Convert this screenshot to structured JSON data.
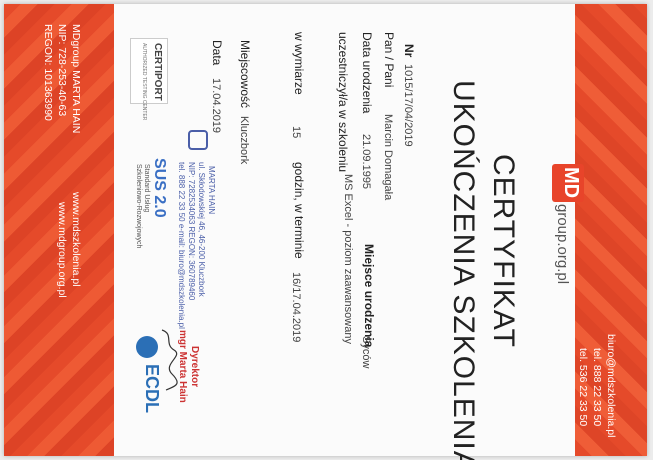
{
  "left_strip": {
    "company": "MDgroup MARTA HAIN",
    "nip": "NIP: 728-253-40-63",
    "regon": "REGON: 101363990",
    "website": "www.mdgroup.org.pl",
    "website2": "www.mdszkolenia.pl"
  },
  "right_strip": {
    "email": "biuro@mdszkolenia.pl",
    "tel1": "tel. 888 22 33 50",
    "tel2": "tel. 536 22 33 50"
  },
  "brand": {
    "logo_letters": "MD",
    "logo_suffix": "group.org.pl"
  },
  "title": {
    "line1": "CERTYFIKAT",
    "line2": "UKOŃCZENIA SZKOLENIA"
  },
  "fields": {
    "nr_label": "Nr",
    "nr_value": "1015/17/04/2019",
    "name_label": "Pan / Pani",
    "name_value": "Marcin Domagała",
    "dob_label": "Data urodzenia",
    "dob_value": "21.09.1995",
    "pob_label": "Miejsce urodzenia",
    "pob_value": "Syców",
    "course_label": "uczestniczył/a w szkoleniu",
    "course_value": "MS Excel - poziom zaawansowany",
    "hours_label": "w wymiarze",
    "hours_value": "15",
    "hours_suffix": "godzin, w terminie",
    "term_value": "16/17.04.2019",
    "place_label": "Miejscowość",
    "place_value": "Kluczbork",
    "date_label": "Data",
    "date_value": "17.04.2019"
  },
  "certiport": {
    "name": "CERTIPORT",
    "sub": "AUTHORIZED TESTING CENTER"
  },
  "stamp": {
    "company": "MARTA HAIN",
    "address": "ul. Skłodowskiej 46, 46-200 Kluczbork",
    "ids": "NIP: 7282534063    REGON: 360789460",
    "contact": "tel. 888 22 33 50  e-mail: biuro@mdszkolenia.pl"
  },
  "sus": {
    "name": "SUS 2.0",
    "sub1": "Standard Usług",
    "sub2": "Szkoleniowo-Rozwojowych"
  },
  "director": {
    "title": "Dyrektor",
    "name": "mgr Marta Hain"
  },
  "ecdl": {
    "name": "ECDL"
  },
  "colors": {
    "accent": "#e54a2a"
  }
}
